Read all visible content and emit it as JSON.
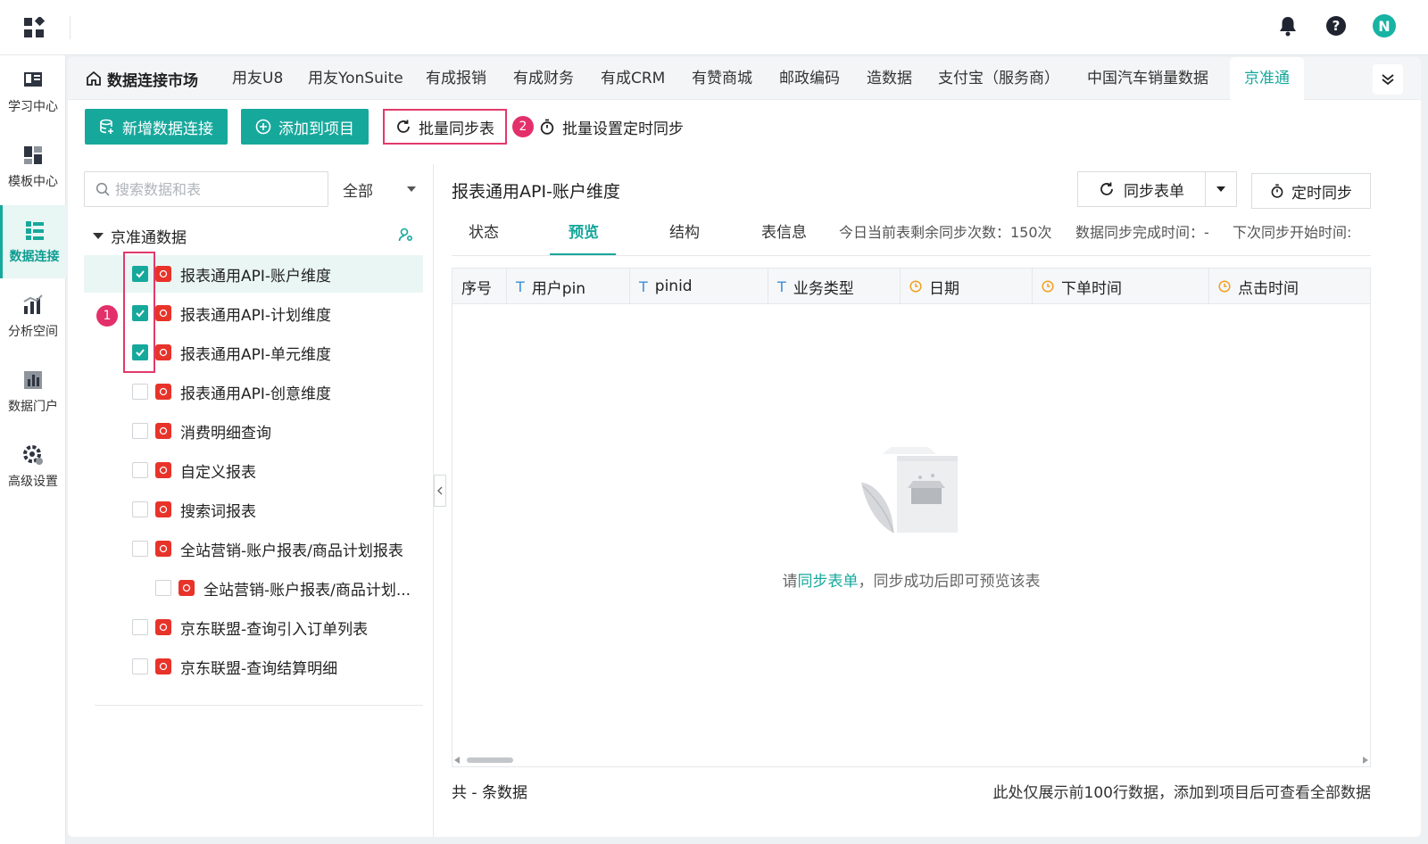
{
  "topbar": {
    "avatar_initial": "N"
  },
  "leftnav": {
    "items": [
      {
        "label": "学习中心",
        "icon": "learn-icon"
      },
      {
        "label": "模板中心",
        "icon": "template-icon"
      },
      {
        "label": "数据连接",
        "icon": "data-connect-icon",
        "active": true
      },
      {
        "label": "分析空间",
        "icon": "analysis-icon"
      },
      {
        "label": "数据门户",
        "icon": "portal-icon"
      },
      {
        "label": "高级设置",
        "icon": "gear-icon"
      }
    ]
  },
  "tabs": {
    "home": "数据连接市场",
    "items": [
      "用友U8",
      "用友YonSuite",
      "有成报销",
      "有成财务",
      "有成CRM",
      "有赞商城",
      "邮政编码",
      "造数据",
      "支付宝（服务商）",
      "中国汽车销量数据",
      "京准通"
    ],
    "active_index": 10
  },
  "toolbar": {
    "new_connection": "新增数据连接",
    "add_to_project": "添加到项目",
    "batch_sync": "批量同步表",
    "batch_timer": "批量设置定时同步",
    "badge_1": "1",
    "badge_2": "2"
  },
  "tree": {
    "search_placeholder": "搜索数据和表",
    "filter_value": "全部",
    "root_label": "京准通数据",
    "items": [
      {
        "label": "报表通用API-账户维度",
        "checked": true,
        "selected": true,
        "indent": 0
      },
      {
        "label": "报表通用API-计划维度",
        "checked": true,
        "indent": 0
      },
      {
        "label": "报表通用API-单元维度",
        "checked": true,
        "indent": 0
      },
      {
        "label": "报表通用API-创意维度",
        "checked": false,
        "indent": 0
      },
      {
        "label": "消费明细查询",
        "checked": false,
        "indent": 0
      },
      {
        "label": "自定义报表",
        "checked": false,
        "indent": 0
      },
      {
        "label": "搜索词报表",
        "checked": false,
        "indent": 0
      },
      {
        "label": "全站营销-账户报表/商品计划报表",
        "checked": false,
        "indent": 0
      },
      {
        "label": "全站营销-账户报表/商品计划...",
        "checked": false,
        "indent": 1
      },
      {
        "label": "京东联盟-查询引入订单列表",
        "checked": false,
        "indent": 0
      },
      {
        "label": "京东联盟-查询结算明细",
        "checked": false,
        "indent": 0
      }
    ]
  },
  "detail": {
    "title": "报表通用API-账户维度",
    "sync_form": "同步表单",
    "timer_sync": "定时同步",
    "subtabs": [
      "状态",
      "预览",
      "结构",
      "表信息"
    ],
    "active_subtab": 1,
    "remaining_sync": "今日当前表剩余同步次数：150次",
    "sync_done_time": "数据同步完成时间：-",
    "next_sync_time": "下次同步开始时间:",
    "columns": [
      {
        "label": "序号",
        "type": "none"
      },
      {
        "label": "用户pin",
        "type": "text"
      },
      {
        "label": "pinid",
        "type": "text"
      },
      {
        "label": "业务类型",
        "type": "text"
      },
      {
        "label": "日期",
        "type": "time"
      },
      {
        "label": "下单时间",
        "type": "time"
      },
      {
        "label": "点击时间",
        "type": "time"
      }
    ],
    "empty_prefix": "请",
    "empty_link": "同步表单",
    "empty_suffix": "，同步成功后即可预览该表",
    "footer_count": "共 - 条数据",
    "footer_note": "此处仅展示前100行数据，添加到项目后可查看全部数据"
  },
  "colors": {
    "accent": "#17a89c",
    "highlight": "#e23a6a",
    "source_icon": "#e8332a"
  }
}
